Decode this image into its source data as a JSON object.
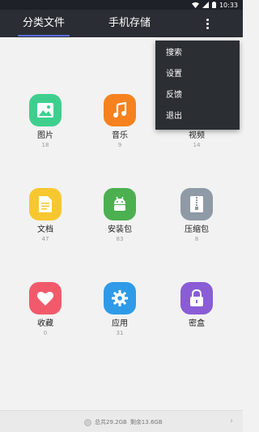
{
  "status_bar": {
    "time": "10:33",
    "icons": [
      "wifi-icon",
      "signal-icon",
      "battery-icon"
    ]
  },
  "tabs": [
    {
      "label": "分类文件",
      "active": true
    },
    {
      "label": "手机存储",
      "active": false
    }
  ],
  "colors": {
    "topbar": "#2a2d33",
    "tab_indicator": "#5b6cf5",
    "menu_bg": "#2b2e33",
    "images": "#3ecf8e",
    "music": "#f5821f",
    "video": "#444a52",
    "documents": "#f7c72f",
    "apk": "#4caf50",
    "archive": "#8e9aa5",
    "favorites": "#f25a6b",
    "apps": "#2f9be8",
    "vault": "#8a5cd6"
  },
  "categories": [
    {
      "label": "图片",
      "count": "18",
      "icon": "image-icon"
    },
    {
      "label": "音乐",
      "count": "9",
      "icon": "music-note-icon"
    },
    {
      "label": "视频",
      "count": "14",
      "icon": "video-icon"
    },
    {
      "label": "文档",
      "count": "47",
      "icon": "document-icon"
    },
    {
      "label": "安装包",
      "count": "83",
      "icon": "android-icon"
    },
    {
      "label": "压缩包",
      "count": "8",
      "icon": "zip-icon"
    },
    {
      "label": "收藏",
      "count": "0",
      "icon": "heart-icon"
    },
    {
      "label": "应用",
      "count": "31",
      "icon": "gear-icon"
    },
    {
      "label": "密盒",
      "count": "",
      "icon": "lock-icon"
    }
  ],
  "menu": {
    "items": [
      "搜索",
      "设置",
      "反馈",
      "退出"
    ]
  },
  "footer": {
    "total": "总共29.2GB",
    "remaining": "剩余13.6GB"
  }
}
